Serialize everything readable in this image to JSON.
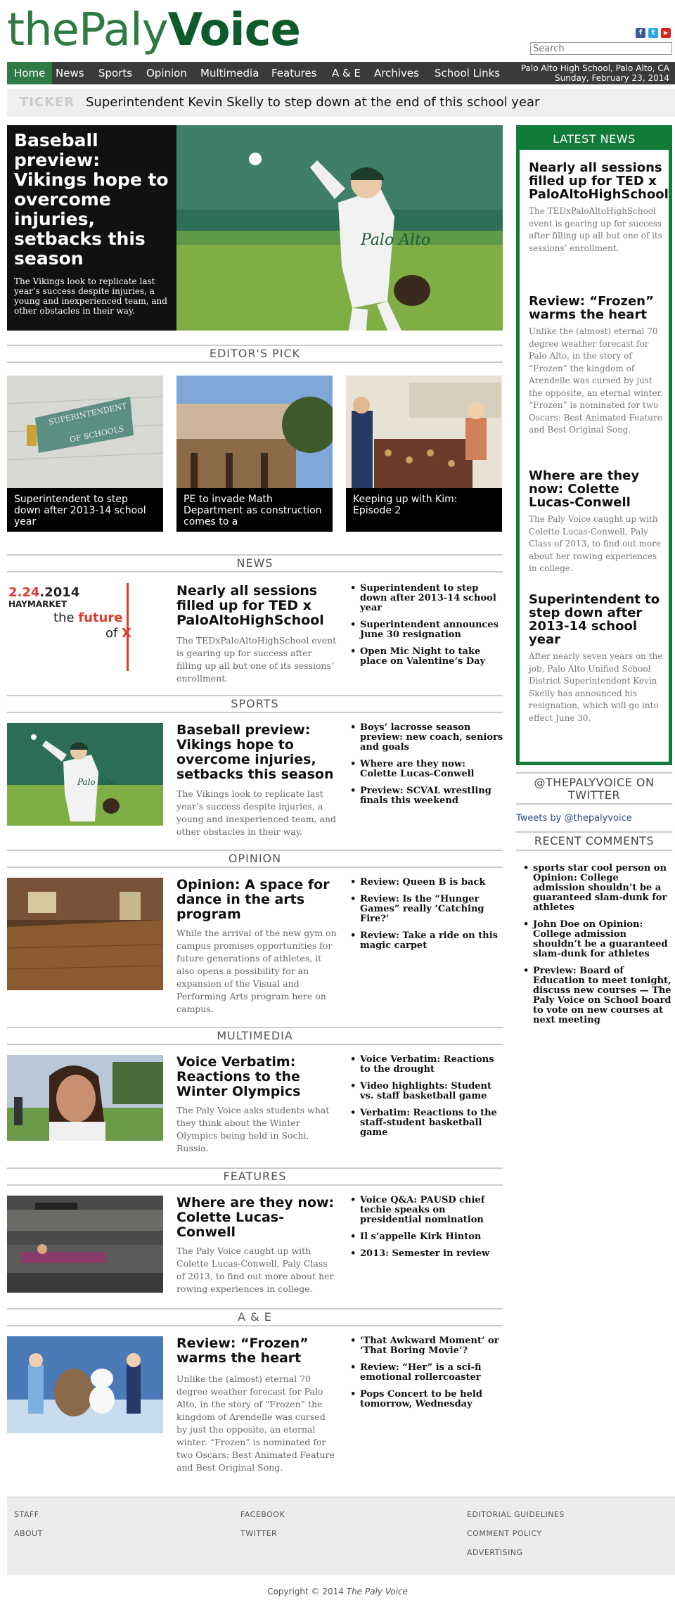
{
  "logo": {
    "part1": "thePaly",
    "part2": "Voice"
  },
  "social": {
    "facebook_glyph": "f",
    "twitter_glyph": "t",
    "youtube_glyph": "▶"
  },
  "search": {
    "placeholder": "Search"
  },
  "nav": {
    "items": [
      "Home",
      "News",
      "Sports",
      "Opinion",
      "Multimedia",
      "Features",
      "A & E",
      "Archives",
      "School Links"
    ],
    "location": "Palo Alto High School, Palo Alto, CA",
    "date": "Sunday, February 23, 2014"
  },
  "ticker": {
    "label": "TICKER",
    "text": "Superintendent Kevin Skelly to step down at the end of this school year"
  },
  "hero": {
    "title": "Baseball preview: Vikings hope to overcome injuries, setbacks this season",
    "desc": "The Vikings look to replicate last year’s success despite injuries, a young and inexperienced team, and other obstacles in their way."
  },
  "editors_pick": {
    "heading": "EDITOR'S PICK",
    "items": [
      {
        "caption": "Superintendent to step down after 2013-14 school year",
        "sign_text": "SUPERINTENDENT OF SCHOOLS"
      },
      {
        "caption": "PE to invade Math Department as construction comes to a"
      },
      {
        "caption": "Keeping up with Kim: Episode 2"
      }
    ]
  },
  "news": {
    "heading": "NEWS",
    "graphic": {
      "date_red": "2.24",
      "year": ".2014",
      "venue": "HAYMARKET",
      "the": "the",
      "future": "future",
      "of": "of",
      "x": "X"
    },
    "title": "Nearly all sessions filled up for TED x PaloAltoHighSchool",
    "desc": "The TEDxPaloAltoHighSchool event is gearing up for success after filling up all but one of its sessions’ enrollment.",
    "links": [
      "Superintendent to step down after 2013-14 school year",
      "Superintendent announces June 30 resignation",
      "Open Mic Night to take place on Valentine’s Day"
    ]
  },
  "sports": {
    "heading": "SPORTS",
    "title": "Baseball preview: Vikings hope to overcome injuries, setbacks this season",
    "desc": "The Vikings look to replicate last year’s success despite injuries, a young and inexperienced team, and other obstacles in their way.",
    "links": [
      "Boys’ lacrosse season preview: new coach, seniors and goals",
      "Where are they now: Colette Lucas-Conwell",
      "Preview: SCVAL wrestling finals this weekend"
    ]
  },
  "opinion": {
    "heading": "OPINION",
    "title": "Opinion: A space for dance in the arts program",
    "desc": "While the arrival of the new gym on campus promises opportunities for future generations of athletes, it also opens a possibility for an expansion of the Visual and Performing Arts program here on campus.",
    "links": [
      "Review: Queen B is back",
      "Review: Is the “Hunger Games” really ‘Catching Fire?’",
      "Review: Take a ride on this magic carpet"
    ]
  },
  "multimedia": {
    "heading": "MULTIMEDIA",
    "title": "Voice Verbatim: Reactions to the Winter Olympics",
    "desc": "The Paly Voice asks students what they think about the Winter Olympics being held in Sochi, Russia.",
    "links": [
      "Voice Verbatim: Reactions to the drought",
      "Video highlights: Student vs. staff basketball game",
      "Verbatim: Reactions to the staff-student basketball game"
    ]
  },
  "features": {
    "heading": "FEATURES",
    "title": "Where are they now: Colette Lucas-Conwell",
    "desc": "The Paly Voice caught up with Colette Lucas-Conwell, Paly Class of 2013, to find out more about her rowing experiences in college.",
    "links": [
      "Voice Q&A: PAUSD chief techie speaks on presidential nomination",
      "Il s’appelle Kirk Hinton",
      "2013: Semester in review"
    ]
  },
  "ae": {
    "heading": "A & E",
    "title": "Review: “Frozen” warms the heart",
    "desc": "Unlike the (almost) eternal 70 degree weather forecast for Palo Alto, in the story of “Frozen” the kingdom of Arendelle was cursed by just the opposite, an eternal winter. “Frozen” is nominated for two Oscars: Best Animated Feature and Best Original Song.",
    "links": [
      "‘That Awkward Moment’ or ‘That Boring Movie’?",
      "Review: “Her” is a sci-fi emotional rollercoaster",
      "Pops Concert to be held tomorrow, Wednesday"
    ]
  },
  "latest": {
    "heading": "LATEST NEWS",
    "items": [
      {
        "title": "Nearly all sessions filled up for TED x PaloAltoHighSchool",
        "desc": "The TEDxPaloAltoHighSchool event is gearing up for success after filling up all but one of its sessions’ enrollment."
      },
      {
        "title": "Review: “Frozen” warms the heart",
        "desc": "Unlike the (almost) eternal 70 degree weather forecast for Palo Alto, in the story of “Frozen” the kingdom of Arendelle was cursed by just the opposite, an eternal winter. “Frozen” is nominated for two Oscars: Best Animated Feature and Best Original Song."
      },
      {
        "title": "Where are they now: Colette Lucas-Conwell",
        "desc": "The Paly Voice caught up with Colette Lucas-Conwell, Paly Class of 2013, to find out more about her rowing experiences in college."
      },
      {
        "title": "Superintendent to step down after 2013-14 school year",
        "desc": "After nearly seven years on the job, Palo Alto Unified School District Superintendent Kevin Skelly has announced his resignation, which will go into effect June 30."
      }
    ]
  },
  "twitter": {
    "heading": "@THEPALYVOICE ON TWITTER",
    "link": "Tweets by @thepalyvoice"
  },
  "comments": {
    "heading": "RECENT COMMENTS",
    "items": [
      "sports star cool person on Opinion: College admission shouldn’t be a guaranteed slam-dunk for athletes",
      "John Doe on Opinion: College admission shouldn’t be a guaranteed slam-dunk for athletes",
      "Preview: Board of Education to meet tonight, discuss new courses — The Paly Voice on School board to vote on new courses at next meeting"
    ]
  },
  "footer": {
    "col1": [
      "STAFF",
      "ABOUT"
    ],
    "col2": [
      "FACEBOOK",
      "TWITTER"
    ],
    "col3": [
      "EDITORIAL GUIDELINES",
      "COMMENT POLICY",
      "ADVERTISING"
    ],
    "copyright": "Copyright © 2014",
    "copyright_name": "The Paly Voice"
  },
  "colors": {
    "brand_green": "#137b3a",
    "nav_bg": "#3a3a3a",
    "ticker_bg": "#efefef",
    "accent_red": "#e03a2a"
  }
}
